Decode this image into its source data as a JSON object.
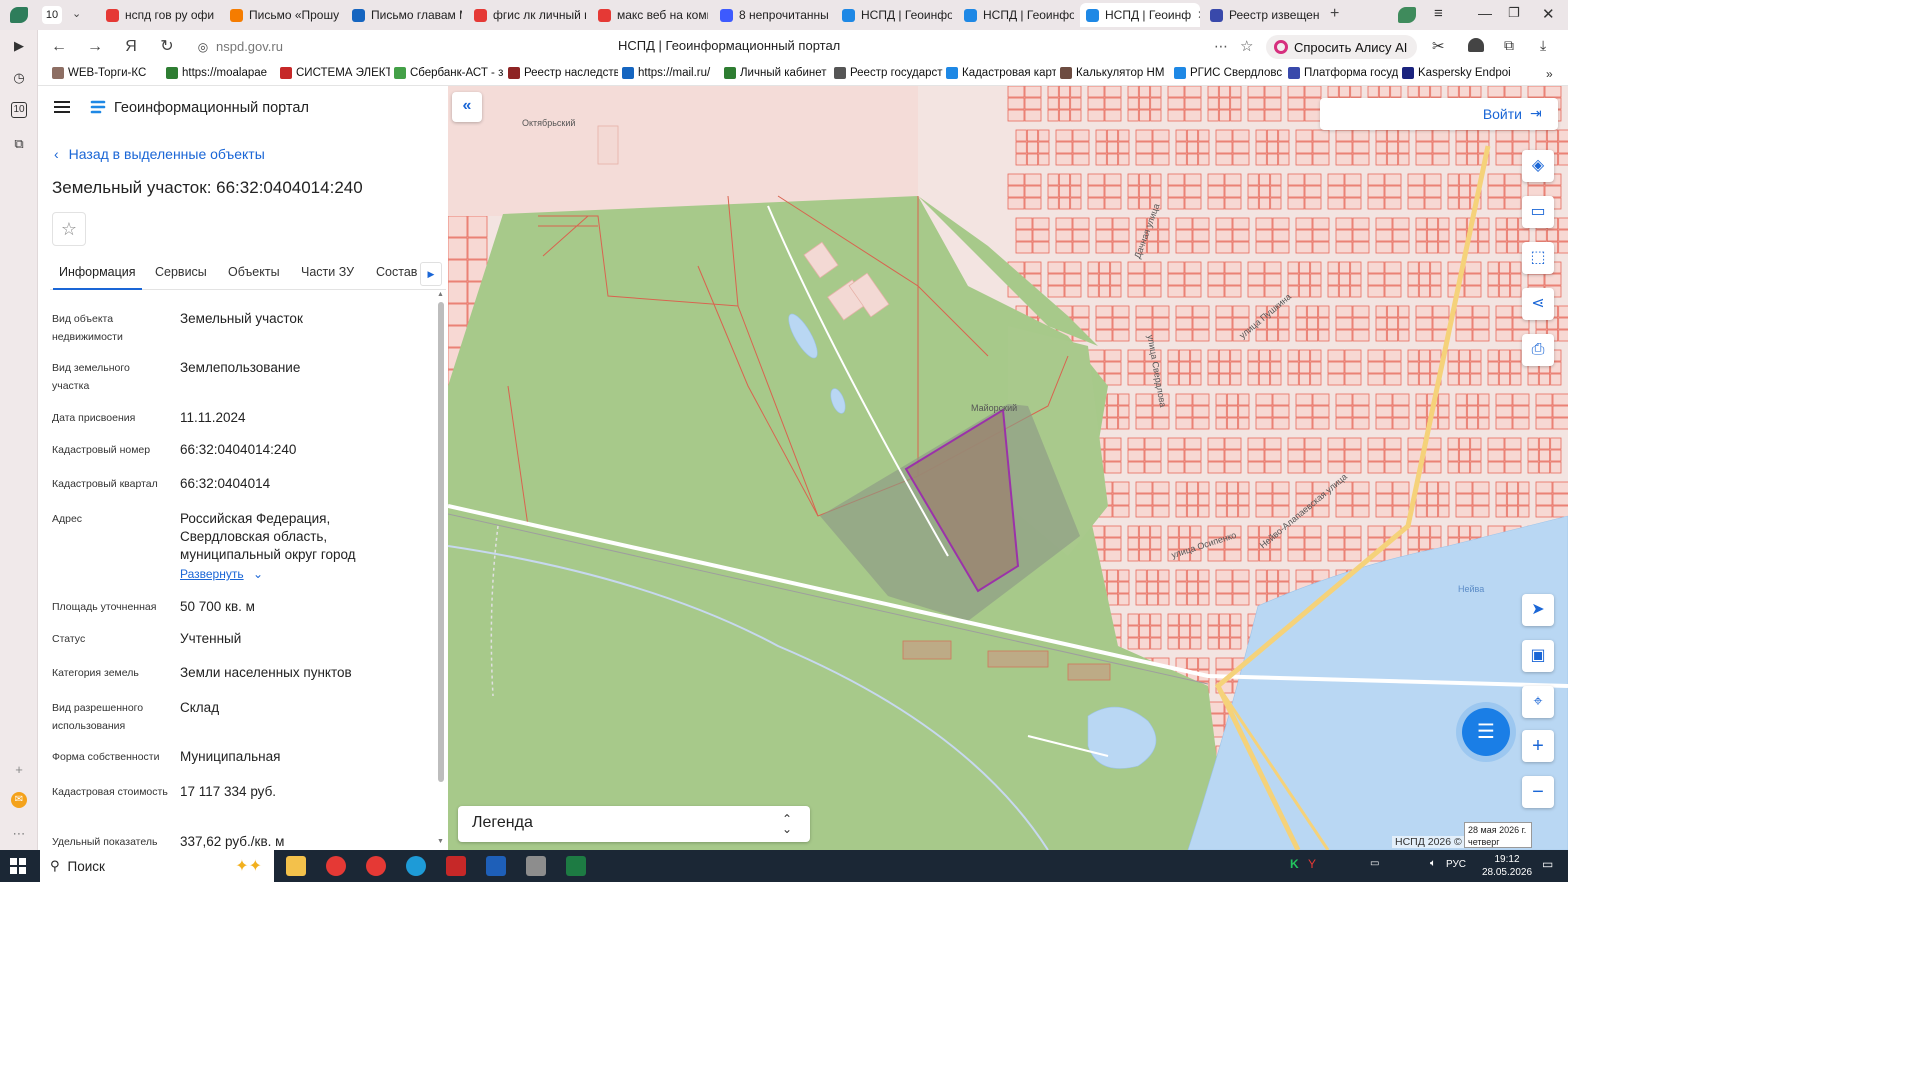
{
  "browser": {
    "tab_count": "10",
    "tabs": [
      {
        "label": "нспд гов ру офи",
        "color": "#e53935"
      },
      {
        "label": "Письмо «Прошу",
        "color": "#f57c00"
      },
      {
        "label": "Письмо главам М",
        "color": "#1565c0"
      },
      {
        "label": "фгис лк личный к",
        "color": "#e53935"
      },
      {
        "label": "макс веб на комп",
        "color": "#e53935"
      },
      {
        "label": "8 непрочитанны",
        "color": "#3d5afe"
      },
      {
        "label": "НСПД | Геоинфор",
        "color": "#1e88e5"
      },
      {
        "label": "НСПД | Геоинфор",
        "color": "#1e88e5"
      },
      {
        "label": "НСПД | Геоинф",
        "color": "#1e88e5"
      },
      {
        "label": "Реестр извещени",
        "color": "#3949ab"
      }
    ],
    "url": "nspd.gov.ru",
    "page_title": "НСПД | Геоинформационный портал",
    "alice_label": "Спросить Алису AI",
    "bookmarks": [
      {
        "label": "WEB-Торги-КС",
        "color": "#8d6e63"
      },
      {
        "label": "https://moalapae",
        "color": "#2e7d32"
      },
      {
        "label": "СИСТЕМА ЭЛЕКТ",
        "color": "#c62828"
      },
      {
        "label": "Сбербанк-АСТ - з",
        "color": "#43a047"
      },
      {
        "label": "Реестр наследств",
        "color": "#8e2424"
      },
      {
        "label": "https://mail.ru/",
        "color": "#1565c0"
      },
      {
        "label": "Личный кабинет",
        "color": "#2e7d32"
      },
      {
        "label": "Реестр государст",
        "color": "#555555"
      },
      {
        "label": "Кадастровая карт",
        "color": "#1e88e5"
      },
      {
        "label": "Калькулятор НМ",
        "color": "#6d4c41"
      },
      {
        "label": "РГИС Свердловс",
        "color": "#1e88e5"
      },
      {
        "label": "Платформа госуд",
        "color": "#3949ab"
      },
      {
        "label": "Kaspersky Endpoi",
        "color": "#1a237e"
      }
    ]
  },
  "panel": {
    "portal_name": "Геоинформационный портал",
    "back_label": "Назад в выделенные объекты",
    "object_title": "Земельный участок: 66:32:0404014:240",
    "tabs": [
      "Информация",
      "Сервисы",
      "Объекты",
      "Части ЗУ",
      "Состав"
    ],
    "fields": [
      {
        "label": "Вид объекта недвижимости",
        "value": "Земельный участок"
      },
      {
        "label": "Вид земельного участка",
        "value": "Землепользование"
      },
      {
        "label": "Дата присвоения",
        "value": "11.11.2024"
      },
      {
        "label": "Кадастровый номер",
        "value": "66:32:0404014:240"
      },
      {
        "label": "Кадастровый квартал",
        "value": "66:32:0404014"
      },
      {
        "label": "Адрес",
        "value": "Российская Федерация, Свердловская область, муниципальный округ город"
      },
      {
        "label": "Площадь уточненная",
        "value": "50 700 кв. м"
      },
      {
        "label": "Статус",
        "value": "Учтенный"
      },
      {
        "label": "Категория земель",
        "value": "Земли населенных пунктов"
      },
      {
        "label": "Вид разрешенного использования",
        "value": "Склад"
      },
      {
        "label": "Форма собственности",
        "value": "Муниципальная"
      },
      {
        "label": "Кадастровая стоимость",
        "value": "17 117 334 руб."
      },
      {
        "label": "Удельный показатель",
        "value": "337,62 руб./кв. м"
      }
    ],
    "expand_label": "Развернуть"
  },
  "map": {
    "login_label": "Войти",
    "legend_label": "Легенда",
    "copyright": "НСПД 2026 ©",
    "labels": {
      "district": "Октябрьский",
      "mayorskiy": "Майорский",
      "river": "Нейва",
      "street_osipenko": "улица Осипенко",
      "street_sverdlova": "улица Свердлова",
      "street_dachnaya": "Дачная улица",
      "street_pushkina": "улица Пушкина",
      "street_neivo": "Нейво-Алапаевская улица"
    },
    "colors": {
      "green": "#a7c98a",
      "parcel_stroke": "#e0503e",
      "selected": "#9c1eb0",
      "road": "#f5d27a",
      "water": "#b9d7f3"
    }
  },
  "taskbar": {
    "search_label": "Поиск",
    "lang": "РУС",
    "time": "19:12",
    "date": "28.05.2026",
    "tooltip_date": "28 мая 2026 г.",
    "tooltip_day": "четверг"
  }
}
